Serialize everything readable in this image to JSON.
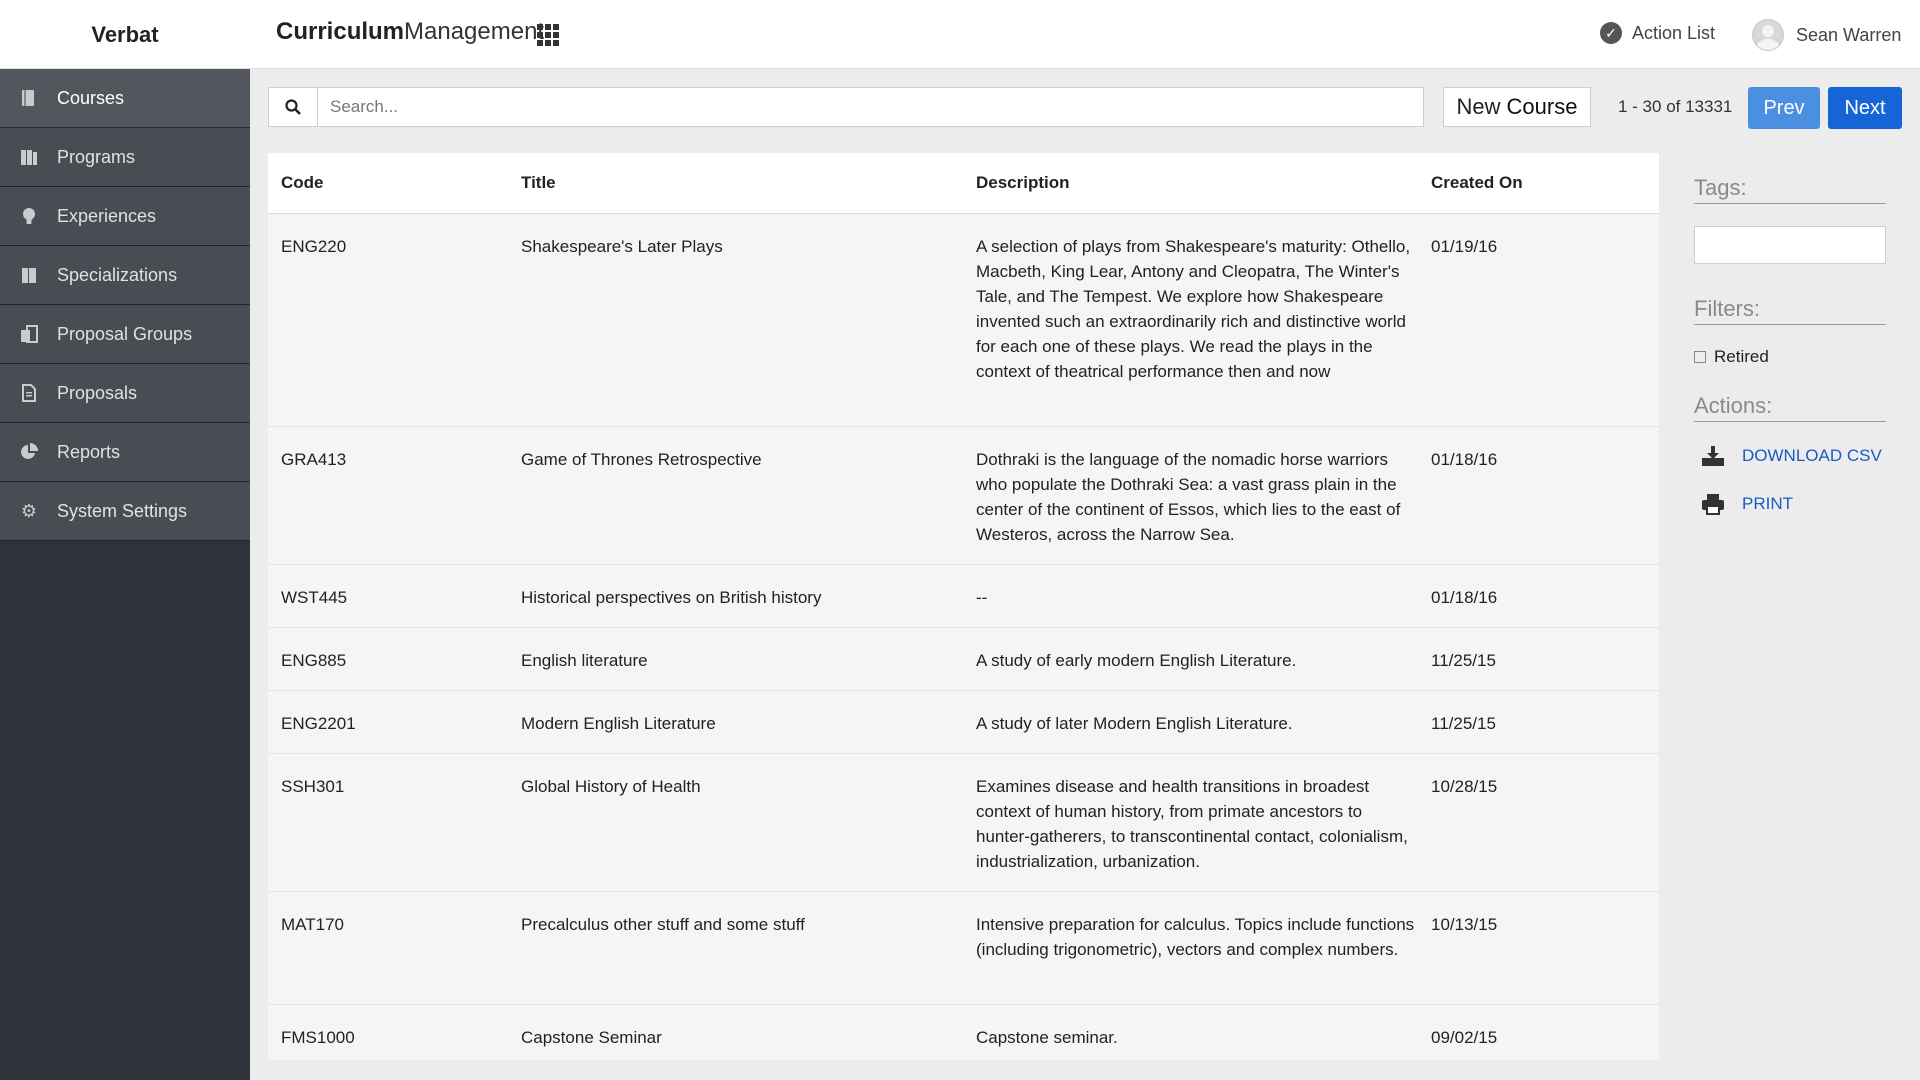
{
  "topbar": {
    "brand": "Verbat",
    "app_title_bold": "Curriculum",
    "app_title_light": "Management",
    "action_list": "Action List",
    "user_name": "Sean Warren",
    "icons": [
      "apps-grid-icon",
      "check-circle-icon",
      "user-avatar-icon"
    ]
  },
  "sidebar": {
    "items": [
      {
        "label": "Courses",
        "icon": "courses-icon",
        "active": true
      },
      {
        "label": "Programs",
        "icon": "programs-icon"
      },
      {
        "label": "Experiences",
        "icon": "lightbulb-icon"
      },
      {
        "label": "Specializations",
        "icon": "specializations-icon"
      },
      {
        "label": "Proposal Groups",
        "icon": "proposal-groups-icon"
      },
      {
        "label": "Proposals",
        "icon": "document-icon"
      },
      {
        "label": "Reports",
        "icon": "pie-chart-icon"
      },
      {
        "label": "System Settings",
        "icon": "gear-icon"
      }
    ]
  },
  "toolbar": {
    "search_placeholder": "Search...",
    "new_label_1": "New",
    "new_label_2": "Course",
    "pager_text": "1 - 30 of 13331",
    "prev": "Prev",
    "next": "Next"
  },
  "table": {
    "headers": [
      "Code",
      "Title",
      "Description",
      "Created On"
    ],
    "rows": [
      {
        "code": "ENG220",
        "title": "Shakespeare's Later Plays",
        "description": "A selection of plays from Shakespeare's maturity: Othello, Macbeth, King Lear, Antony and Cleopatra, The Winter's Tale, and The Tempest. We explore how Shakespeare invented such an extraordinarily rich and distinctive world for each one of these plays. We read the plays in the context of theatrical performance then and now",
        "created": "01/19/16"
      },
      {
        "code": "GRA413",
        "title": "Game of Thrones Retrospective",
        "description": "Dothraki is the language of the nomadic horse warriors who populate the Dothraki Sea: a vast grass plain in the center of the continent of Essos, which lies to the east of Westeros, across the Narrow Sea.",
        "created": "01/18/16"
      },
      {
        "code": "WST445",
        "title": "Historical perspectives on British history",
        "description": "--",
        "created": "01/18/16"
      },
      {
        "code": "ENG885",
        "title": "English literature",
        "description": "A study of early modern English Literature.",
        "created": "11/25/15"
      },
      {
        "code": "ENG2201",
        "title": "Modern English Literature",
        "description": "A study of later Modern English Literature.",
        "created": "11/25/15"
      },
      {
        "code": "SSH301",
        "title": "Global History of Health",
        "description": "Examines disease and health transitions in broadest context of human history, from primate ancestors to hunter-gatherers, to transcontinental contact, colonialism, industrialization, urbanization.",
        "created": "10/28/15"
      },
      {
        "code": "MAT170",
        "title": "Precalculus other stuff and some stuff",
        "description": "Intensive preparation for calculus. Topics include functions (including trigonometric), vectors and complex numbers.",
        "created": "10/13/15"
      },
      {
        "code": "FMS1000",
        "title": "Capstone Seminar",
        "description": "Capstone seminar.",
        "created": "09/02/15"
      }
    ]
  },
  "panel": {
    "tags_heading": "Tags:",
    "filters_heading": "Filters:",
    "retired_label": "Retired",
    "actions_heading": "Actions:",
    "download_csv": "DOWNLOAD CSV",
    "print": "PRINT"
  },
  "colors": {
    "sidebar_bg": "#2d3338",
    "nav_item_bg": "#474d52",
    "primary_blue": "#1565d8",
    "link_blue": "#1a5bc4"
  }
}
